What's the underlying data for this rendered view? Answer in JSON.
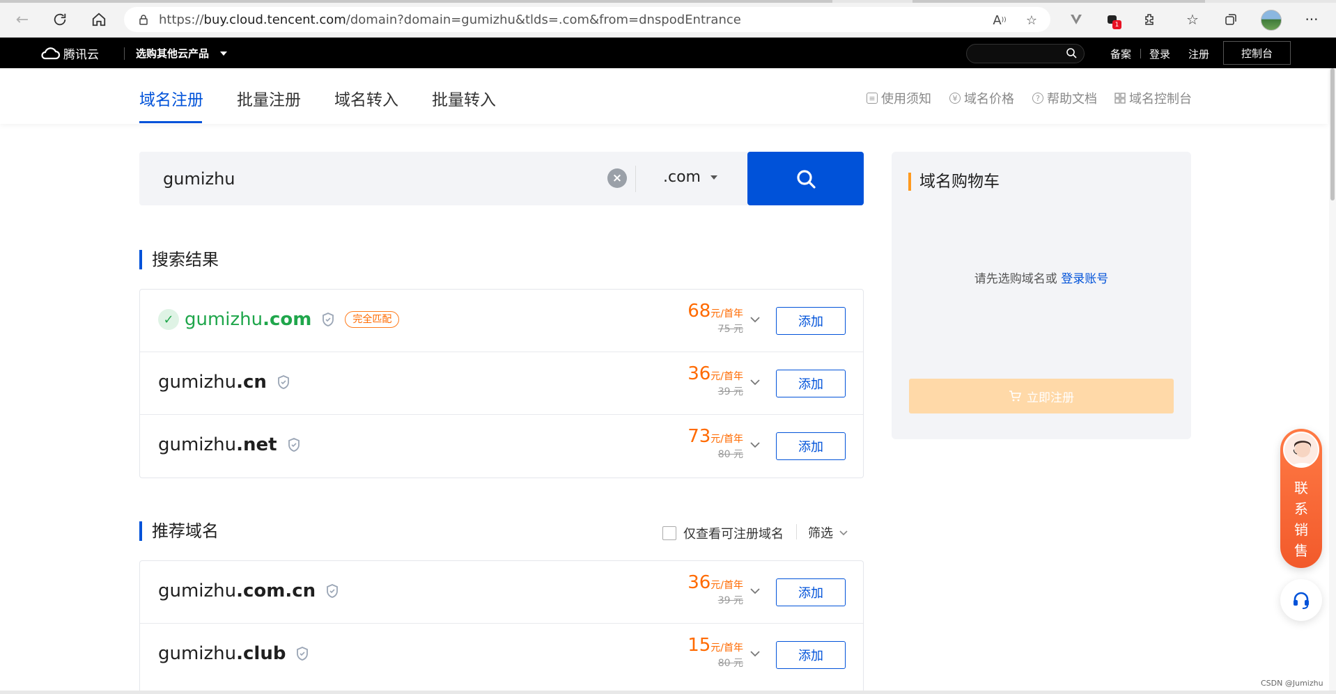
{
  "browser": {
    "url_prefix": "https://",
    "url_host": "buy.cloud.tencent.com",
    "url_rest": "/domain?domain=gumizhu&tlds=.com&from=dnspodEntrance",
    "ext_badge": "1"
  },
  "topnav": {
    "logo_text": "腾讯云",
    "products_label": "选购其他云产品",
    "links": [
      "备案",
      "登录",
      "注册"
    ],
    "console_label": "控制台"
  },
  "subnav": {
    "tabs": [
      "域名注册",
      "批量注册",
      "域名转入",
      "批量转入"
    ],
    "links": [
      "使用须知",
      "域名价格",
      "帮助文档",
      "域名控制台"
    ]
  },
  "search": {
    "query": "gumizhu",
    "tld": ".com"
  },
  "results": {
    "title": "搜索结果",
    "items": [
      {
        "name": "gumizhu",
        "tld": ".com",
        "match_badge": "完全匹配",
        "price": "68",
        "unit": "元/首年",
        "orig": "75 元",
        "add": "添加"
      },
      {
        "name": "gumizhu",
        "tld": ".cn",
        "price": "36",
        "unit": "元/首年",
        "orig": "39 元",
        "add": "添加"
      },
      {
        "name": "gumizhu",
        "tld": ".net",
        "price": "73",
        "unit": "元/首年",
        "orig": "80 元",
        "add": "添加"
      }
    ]
  },
  "recommend": {
    "title": "推荐域名",
    "only_available": "仅查看可注册域名",
    "filter": "筛选",
    "items": [
      {
        "name": "gumizhu",
        "tld": ".com.cn",
        "price": "36",
        "unit": "元/首年",
        "orig": "39 元",
        "add": "添加"
      },
      {
        "name": "gumizhu",
        "tld": ".club",
        "price": "15",
        "unit": "元/首年",
        "orig": "80 元",
        "add": "添加"
      }
    ]
  },
  "cart": {
    "title": "域名购物车",
    "empty_text": "请先选购域名或",
    "login_link": "登录账号",
    "register_button": "立即注册"
  },
  "sales": {
    "text": "联系销售"
  },
  "watermark": "CSDN @Jumizhu"
}
